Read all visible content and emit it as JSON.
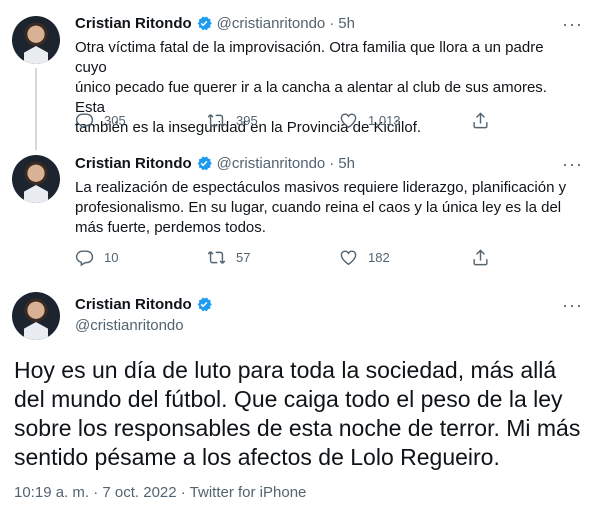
{
  "tweets": [
    {
      "name": "Cristian Ritondo",
      "handle": "@cristianritondo",
      "separator": "·",
      "time": "5h",
      "more": "···",
      "text_lines": [
        "Otra víctima fatal de la improvisación. Otra familia que llora a un padre cuyo",
        "único pecado fue querer ir a la cancha a alentar al club de sus amores. Esta",
        "también es la inseguridad en la Provincia de Kicillof."
      ],
      "replies": "305",
      "retweets": "395",
      "likes": "1.013"
    },
    {
      "name": "Cristian Ritondo",
      "handle": "@cristianritondo",
      "separator": "·",
      "time": "5h",
      "more": "···",
      "text_lines": [
        "La realización de espectáculos masivos requiere liderazgo, planificación y",
        "profesionalismo. En su lugar, cuando reina el caos y la única ley es la del",
        "más fuerte, perdemos todos."
      ],
      "replies": "10",
      "retweets": "57",
      "likes": "182"
    }
  ],
  "main_tweet": {
    "name": "Cristian Ritondo",
    "handle": "@cristianritondo",
    "more": "···",
    "text_lines": [
      "Hoy es un día de luto para toda la sociedad, más allá",
      "del mundo del fútbol. Que caiga todo el peso de la ley",
      "sobre los responsables de esta noche de terror. Mi más",
      "sentido pésame a los afectos de Lolo Regueiro."
    ],
    "meta": "10:19 a. m. · 7 oct. 2022 · Twitter for iPhone"
  },
  "icons": {
    "verified": "verified-badge-icon",
    "reply": "reply-icon",
    "retweet": "retweet-icon",
    "like": "heart-icon",
    "share": "share-icon"
  },
  "colors": {
    "verified": "#1d9bf0",
    "secondary_text": "#536471",
    "thread_line": "#cfd9de"
  }
}
